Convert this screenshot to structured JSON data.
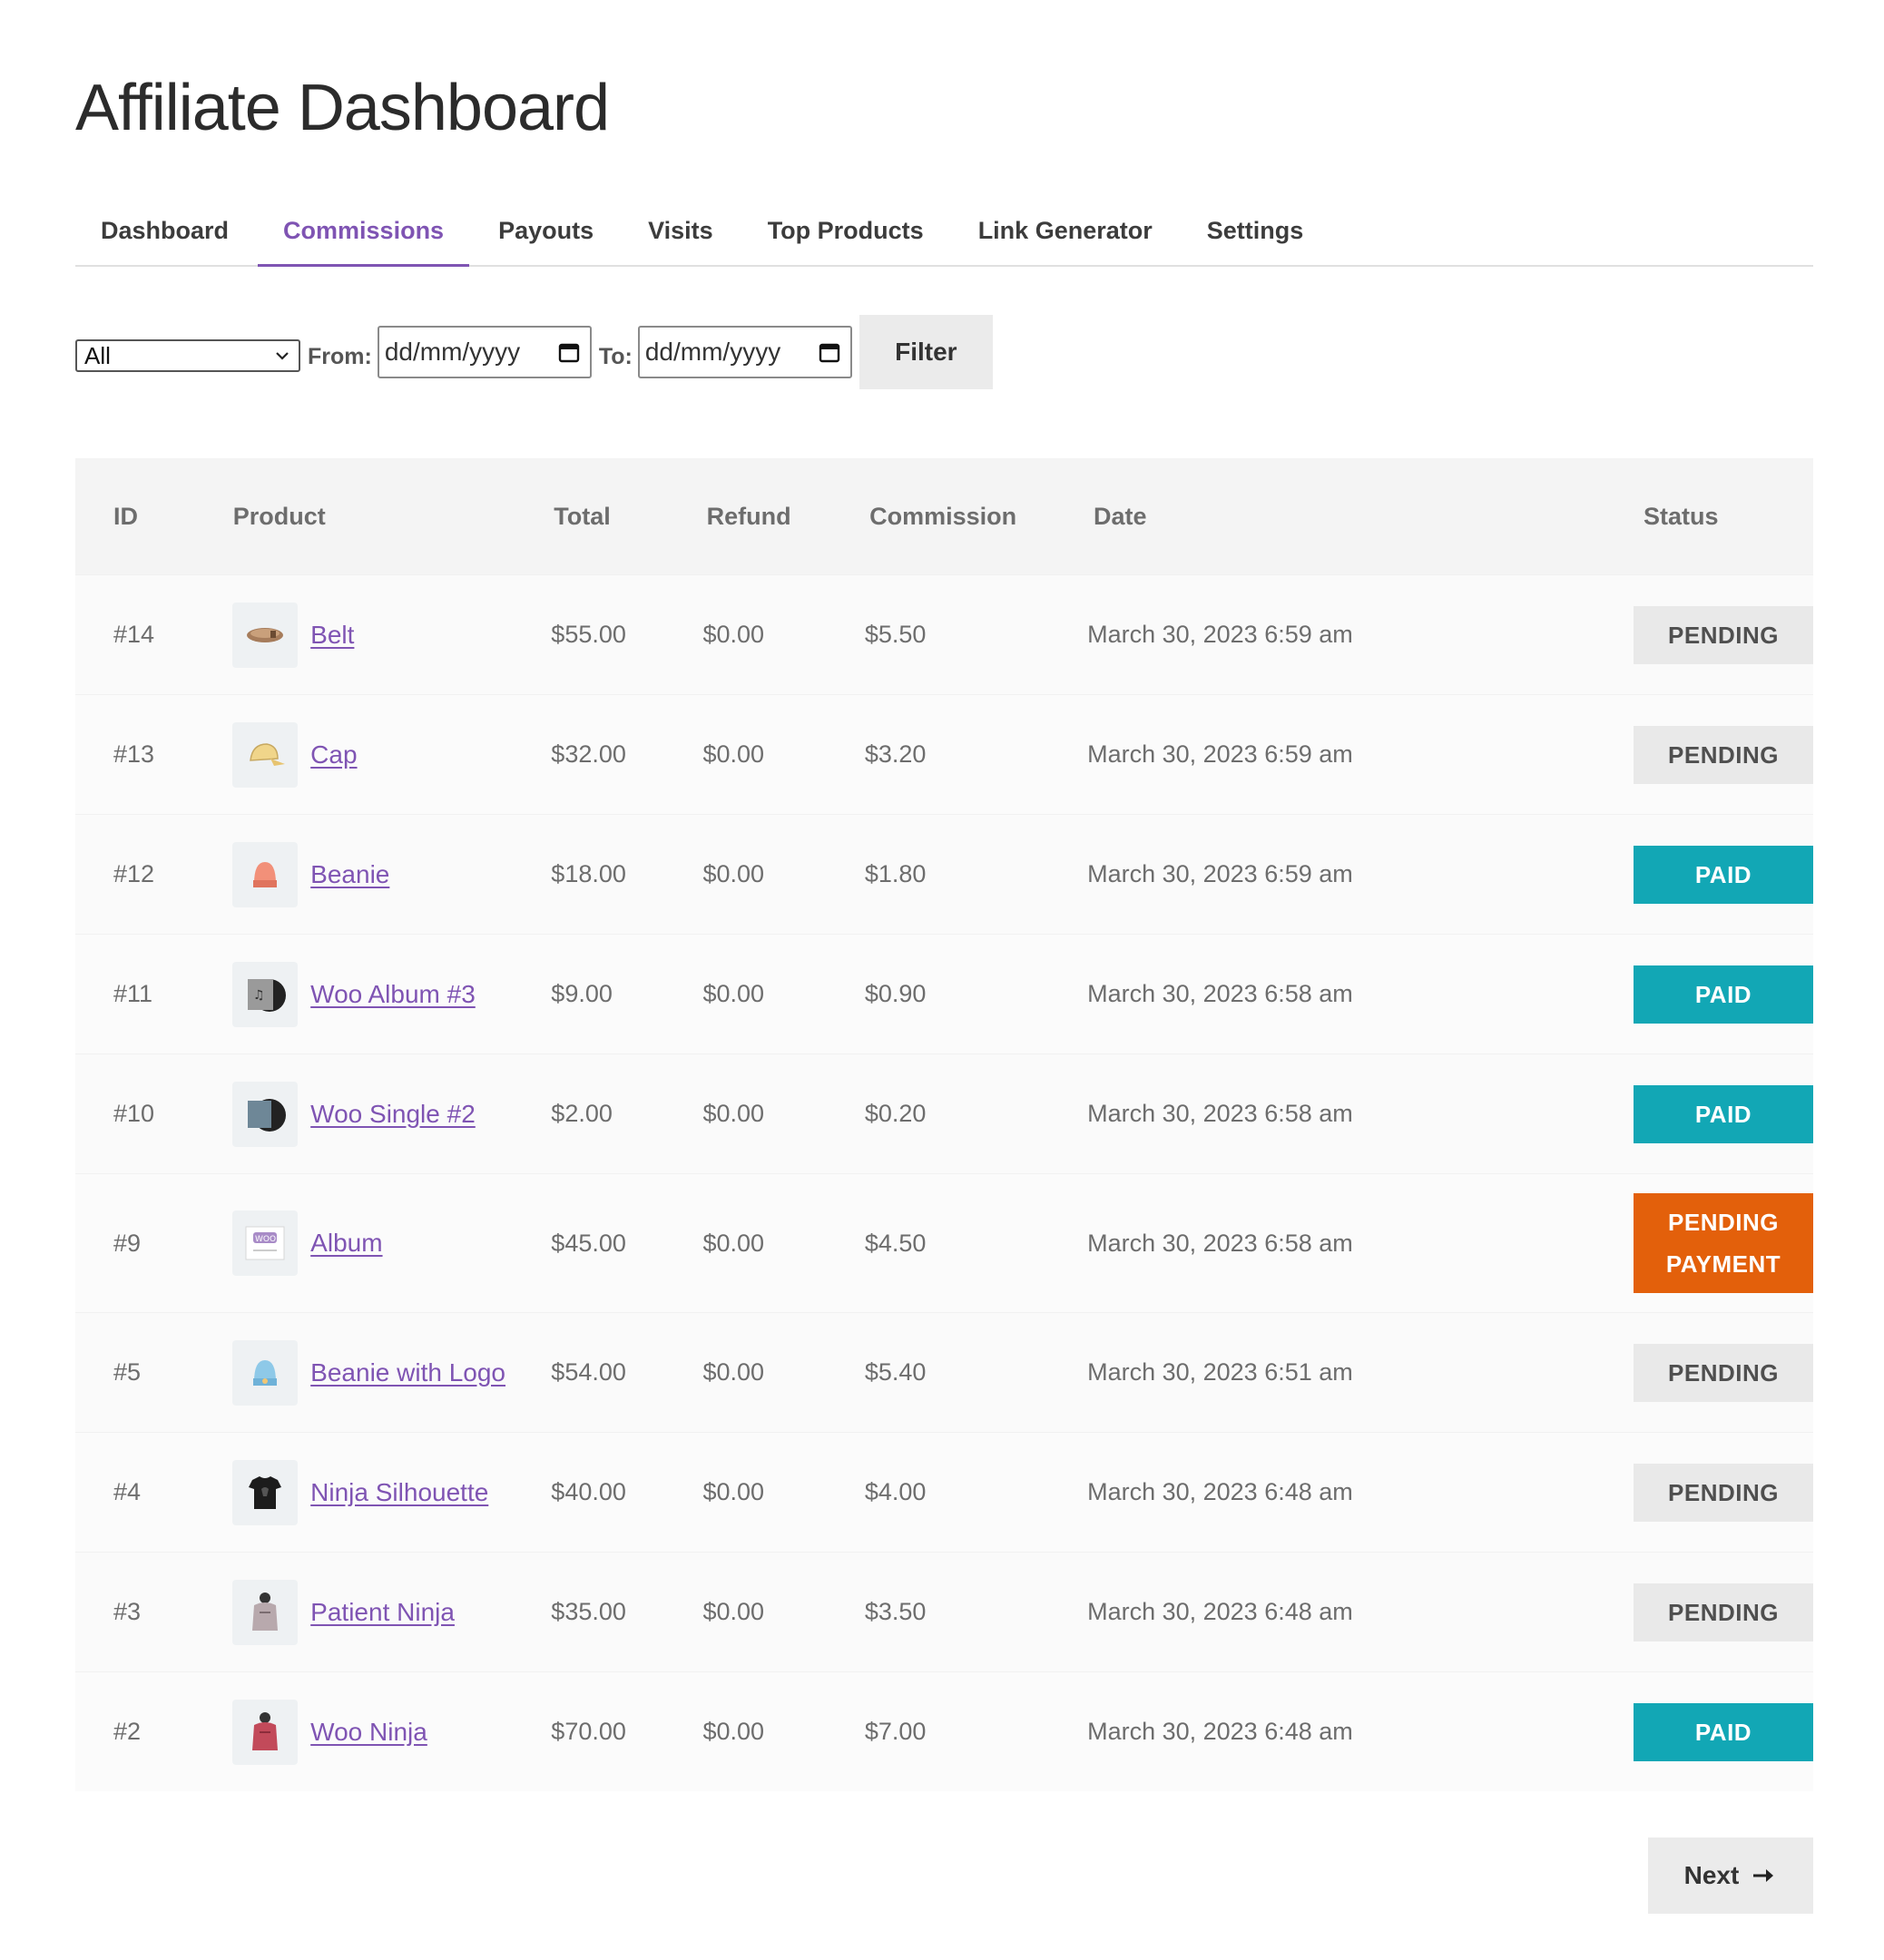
{
  "page": {
    "title": "Affiliate Dashboard"
  },
  "tabs": [
    {
      "label": "Dashboard",
      "active": false
    },
    {
      "label": "Commissions",
      "active": true
    },
    {
      "label": "Payouts",
      "active": false
    },
    {
      "label": "Visits",
      "active": false
    },
    {
      "label": "Top Products",
      "active": false
    },
    {
      "label": "Link Generator",
      "active": false
    },
    {
      "label": "Settings",
      "active": false
    }
  ],
  "filters": {
    "status_selected": "All",
    "from_label": "From:",
    "to_label": "To:",
    "from_value": "dd/mm/yyyy",
    "to_value": "dd/mm/yyyy",
    "filter_button": "Filter"
  },
  "table": {
    "headers": {
      "id": "ID",
      "product": "Product",
      "total": "Total",
      "refund": "Refund",
      "commission": "Commission",
      "date": "Date",
      "status": "Status"
    },
    "rows": [
      {
        "id": "#14",
        "product": "Belt",
        "total": "$55.00",
        "refund": "$0.00",
        "commission": "$5.50",
        "date": "March 30, 2023 6:59 am",
        "status": "PENDING",
        "status_type": "pending",
        "thumb_icon": "belt-icon"
      },
      {
        "id": "#13",
        "product": "Cap",
        "total": "$32.00",
        "refund": "$0.00",
        "commission": "$3.20",
        "date": "March 30, 2023 6:59 am",
        "status": "PENDING",
        "status_type": "pending",
        "thumb_icon": "cap-icon"
      },
      {
        "id": "#12",
        "product": "Beanie",
        "total": "$18.00",
        "refund": "$0.00",
        "commission": "$1.80",
        "date": "March 30, 2023 6:59 am",
        "status": "PAID",
        "status_type": "paid",
        "thumb_icon": "beanie-icon"
      },
      {
        "id": "#11",
        "product": "Woo Album #3",
        "total": "$9.00",
        "refund": "$0.00",
        "commission": "$0.90",
        "date": "March 30, 2023 6:58 am",
        "status": "PAID",
        "status_type": "paid",
        "thumb_icon": "album-icon"
      },
      {
        "id": "#10",
        "product": "Woo Single #2",
        "total": "$2.00",
        "refund": "$0.00",
        "commission": "$0.20",
        "date": "March 30, 2023 6:58 am",
        "status": "PAID",
        "status_type": "paid",
        "thumb_icon": "single-icon"
      },
      {
        "id": "#9",
        "product": "Album",
        "total": "$45.00",
        "refund": "$0.00",
        "commission": "$4.50",
        "date": "March 30, 2023 6:58 am",
        "status": "PENDING PAYMENT",
        "status_type": "pendpay",
        "thumb_icon": "woo-album-icon"
      },
      {
        "id": "#5",
        "product": "Beanie with Logo",
        "total": "$54.00",
        "refund": "$0.00",
        "commission": "$5.40",
        "date": "March 30, 2023 6:51 am",
        "status": "PENDING",
        "status_type": "pending",
        "thumb_icon": "beanie-logo-icon"
      },
      {
        "id": "#4",
        "product": "Ninja Silhouette",
        "total": "$40.00",
        "refund": "$0.00",
        "commission": "$4.00",
        "date": "March 30, 2023 6:48 am",
        "status": "PENDING",
        "status_type": "pending",
        "thumb_icon": "tshirt-icon"
      },
      {
        "id": "#3",
        "product": "Patient Ninja",
        "total": "$35.00",
        "refund": "$0.00",
        "commission": "$3.50",
        "date": "March 30, 2023 6:48 am",
        "status": "PENDING",
        "status_type": "pending",
        "thumb_icon": "hoodie-grey-icon"
      },
      {
        "id": "#2",
        "product": "Woo Ninja",
        "total": "$70.00",
        "refund": "$0.00",
        "commission": "$7.00",
        "date": "March 30, 2023 6:48 am",
        "status": "PAID",
        "status_type": "paid",
        "thumb_icon": "hoodie-red-icon"
      }
    ]
  },
  "pagination": {
    "next_label": "Next",
    "next_icon": "arrow-right-icon"
  },
  "colors": {
    "accent": "#7f54b3",
    "paid": "#12a7b5",
    "pending_payment": "#e3600b",
    "pending": "#e9e9e9"
  }
}
